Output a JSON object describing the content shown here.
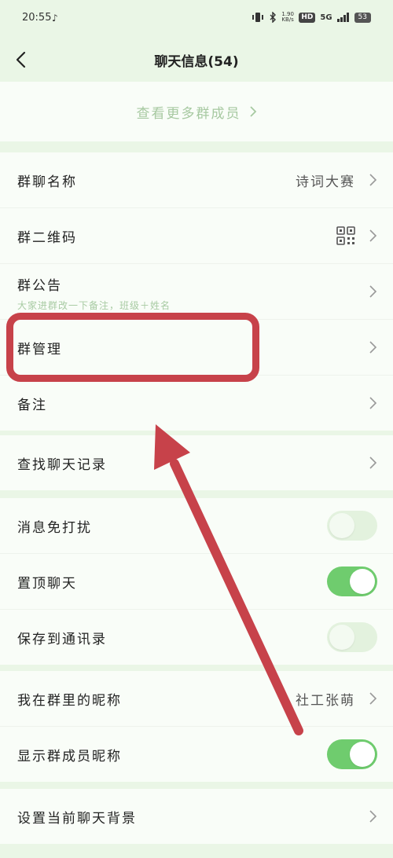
{
  "status_bar": {
    "time": "20:55",
    "network": "5G",
    "hd": "HD",
    "speed": "1.90\nKB/s",
    "battery": "53"
  },
  "header": {
    "title": "聊天信息(54)",
    "back_icon": "chevron-left-icon"
  },
  "members": {
    "view_more_label": "查看更多群成员"
  },
  "group_settings": {
    "name_label": "群聊名称",
    "name_value": "诗词大赛",
    "qr_label": "群二维码",
    "notice_label": "群公告",
    "notice_preview": "大家进群改一下备注，班级＋姓名",
    "manage_label": "群管理",
    "remark_label": "备注"
  },
  "search": {
    "label": "查找聊天记录"
  },
  "toggles": {
    "mute_label": "消息免打扰",
    "mute_on": false,
    "pin_label": "置顶聊天",
    "pin_on": true,
    "save_label": "保存到通讯录",
    "save_on": false
  },
  "nickname": {
    "my_nickname_label": "我在群里的昵称",
    "my_nickname_value": "社工张萌",
    "show_nicknames_label": "显示群成员昵称",
    "show_nicknames_on": true
  },
  "background": {
    "label": "设置当前聊天背景"
  },
  "colors": {
    "accent": "#6fcc6e",
    "annotation": "#c7424a",
    "page_bg": "#eaf6e6"
  }
}
